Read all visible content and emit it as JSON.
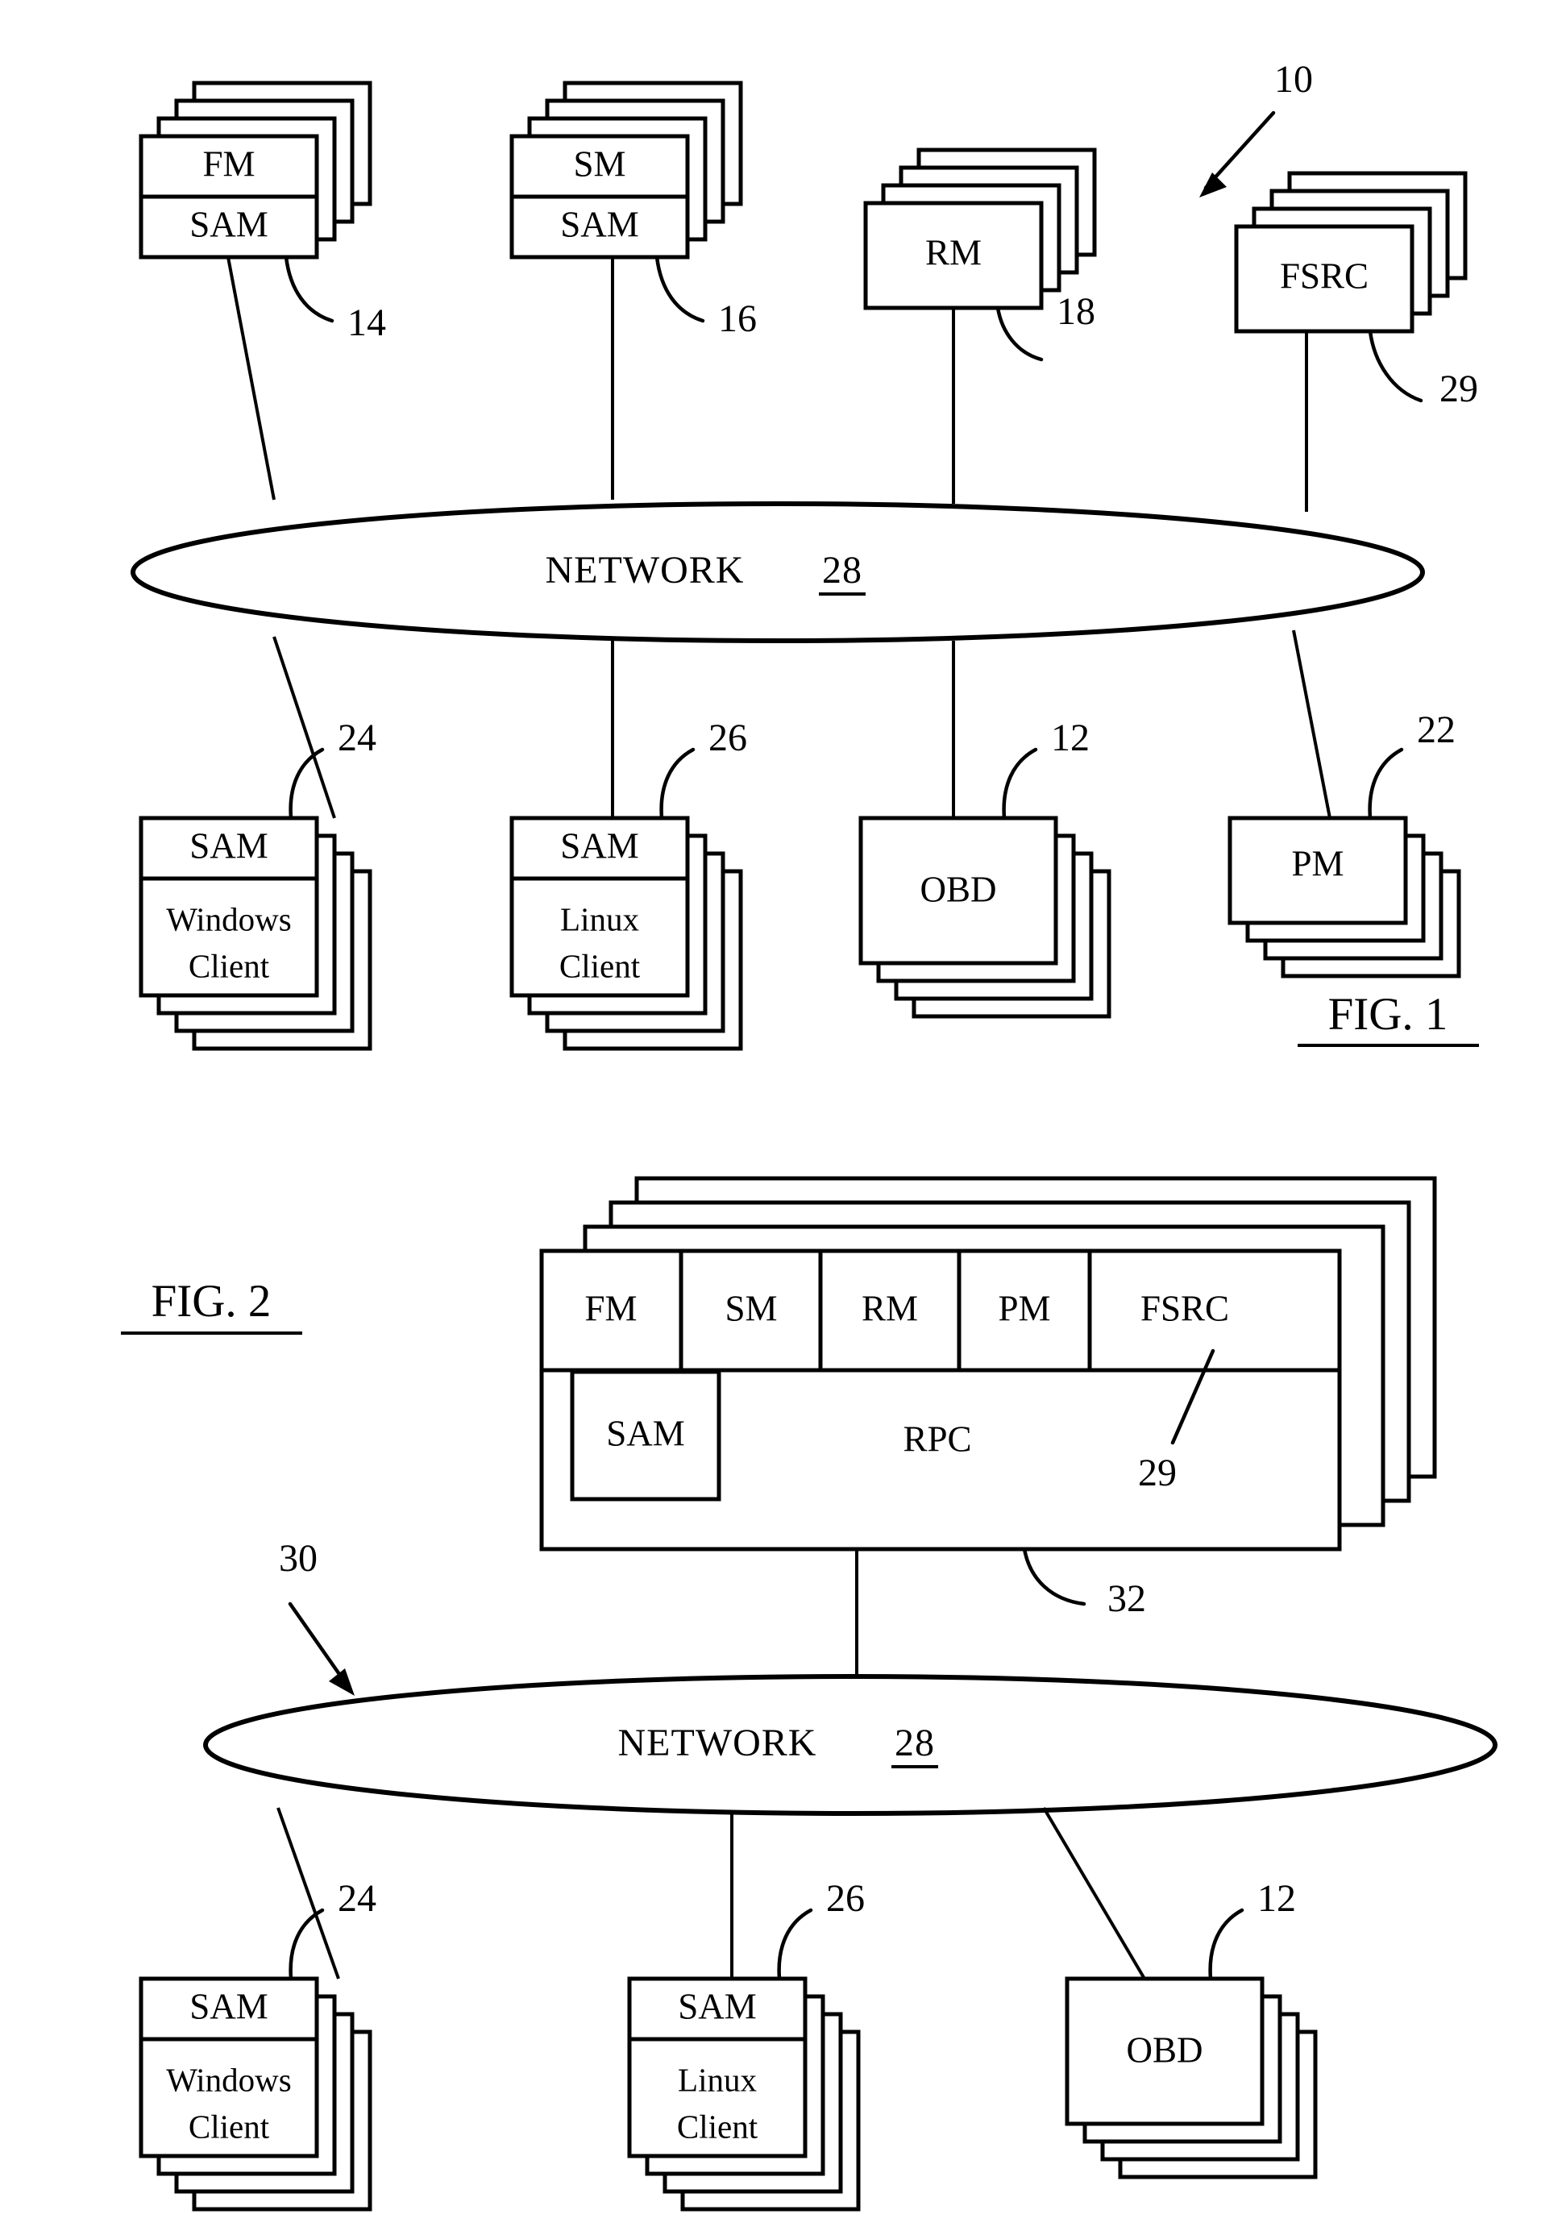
{
  "document": {
    "type": "patent-drawing-sheet",
    "figures": [
      "FIG. 1",
      "FIG. 2"
    ]
  },
  "fig1": {
    "label": "FIG. 1",
    "system_ref": "10",
    "network": {
      "name": "NETWORK",
      "ref": "28"
    },
    "top_nodes": [
      {
        "id": "fm",
        "upper": "FM",
        "lower": "SAM",
        "ref": "14",
        "stack": 3
      },
      {
        "id": "sm",
        "upper": "SM",
        "lower": "SAM",
        "ref": "16",
        "stack": 3
      },
      {
        "id": "rm",
        "upper": "RM",
        "lower": null,
        "ref": "18",
        "stack": 3
      },
      {
        "id": "fsrc",
        "upper": "FSRC",
        "lower": null,
        "ref": "29",
        "stack": 3
      }
    ],
    "bottom_nodes": [
      {
        "id": "windows-client",
        "upper": "SAM",
        "lower_line1": "Windows",
        "lower_line2": "Client",
        "ref": "24",
        "stack": 3
      },
      {
        "id": "linux-client",
        "upper": "SAM",
        "lower_line1": "Linux",
        "lower_line2": "Client",
        "ref": "26",
        "stack": 3
      },
      {
        "id": "obd",
        "upper": "OBD",
        "lower_line1": null,
        "lower_line2": null,
        "ref": "12",
        "stack": 3
      },
      {
        "id": "pm",
        "upper": "PM",
        "lower_line1": null,
        "lower_line2": null,
        "ref": "22",
        "stack": 3
      }
    ]
  },
  "fig2": {
    "label": "FIG. 2",
    "system_ref": "30",
    "server": {
      "ref": "32",
      "stack": 3,
      "modules": [
        "FM",
        "SM",
        "RM",
        "PM",
        "FSRC"
      ],
      "module_ref": "29",
      "sam_label": "SAM",
      "rpc_label": "RPC"
    },
    "network": {
      "name": "NETWORK",
      "ref": "28"
    },
    "bottom_nodes": [
      {
        "id": "windows-client",
        "upper": "SAM",
        "lower_line1": "Windows",
        "lower_line2": "Client",
        "ref": "24",
        "stack": 3
      },
      {
        "id": "linux-client",
        "upper": "SAM",
        "lower_line1": "Linux",
        "lower_line2": "Client",
        "ref": "26",
        "stack": 3
      },
      {
        "id": "obd",
        "upper": "OBD",
        "lower_line1": null,
        "lower_line2": null,
        "ref": "12",
        "stack": 3
      }
    ]
  },
  "colors": {
    "ink": "#000000",
    "paper": "#ffffff"
  }
}
